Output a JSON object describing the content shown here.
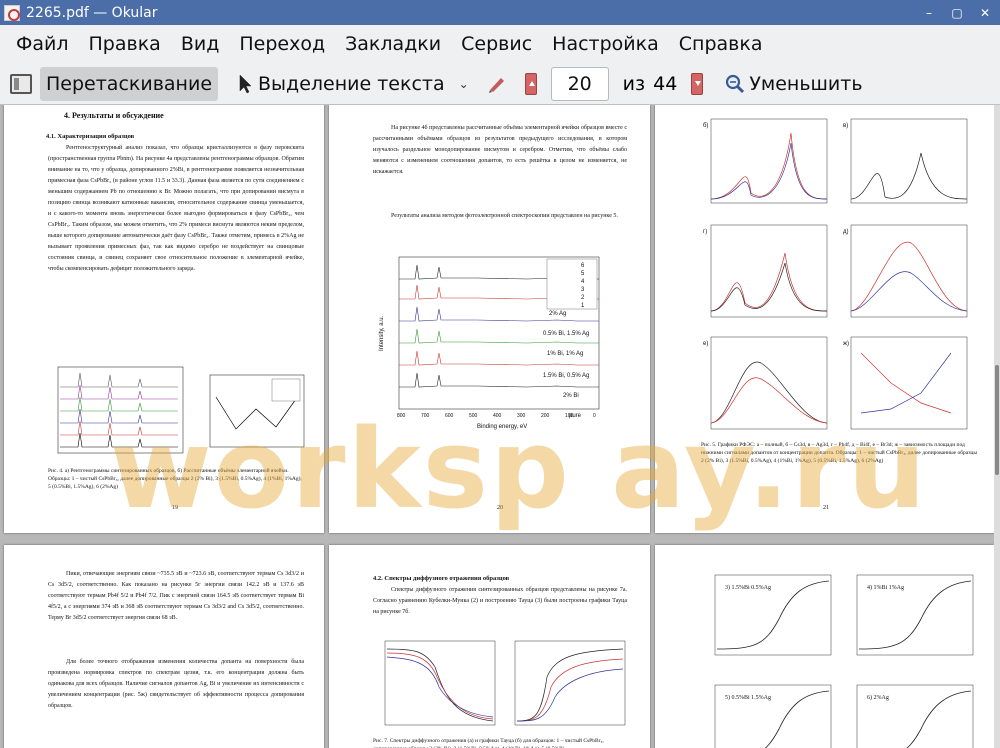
{
  "window": {
    "title": "2265.pdf  — Okular",
    "minimize": "–",
    "maximize": "▢",
    "close": "✕"
  },
  "menu": [
    "Файл",
    "Правка",
    "Вид",
    "Переход",
    "Закладки",
    "Сервис",
    "Настройка",
    "Справка"
  ],
  "toolbar": {
    "drag_label": "Перетаскивание",
    "select_label": "Выделение текста",
    "page_value": "20",
    "of_label": "из",
    "total_pages": "44",
    "zoom_out_label": "Уменьшить"
  },
  "pages": {
    "p19": {
      "heading": "4.  Результаты и обсуждение",
      "subheading": "4.1. Характеризация образцов",
      "body": "Рентгеноструктурный анализ показал, что образцы кристаллизуются в фазу перовскита (пространственная группа Pbnm). На рисунке 4а представлены рентгенограммы образцов. Обратим внимание на то, что у образца, допированного 2%Bi, в рентгенограмме появляется незначительная примесная фаза CsPbBr₂ (в районе углов 11.5 и 33.3). Данная фаза является по сути соединением с меньшим содержанием Pb по отношению к Br. Можно полагать, что при допировании висмута в позицию свинца возникают катионные вакансии, относительное содержание свинца уменьшается, и с какого-то момента вновь энергетически более выгодно формироваться в фазу CsPbBr₂, чем CsPbBr₃. Таким образом, мы можем отметить, что 2% примеси висмута являются неким пределом, выше которого допирование автоматически даёт фазу CsPbBr₂. Также отметим, примесь в 2%Ag не вызывает проявления примесных фаз, так как видимо серебро не воздействует на свинцовые состояния свинца, и свинец сохраняет свое относительное положение в элементарной ячейке, чтобы скомпенсировать дефицит положительного заряда.",
      "caption": "Рис. 4. а) Рентгенограммы синтезированных образцов, б) Рассчитанные объёмы элементарной ячейки. Образцы: 1 – чистый CsPbBr₃, далее допированные образцы 2 (2% Bi), 3 (1.5%Bi, 0.5%Ag), 4 (1%Bi, 1%Ag), 5 (0.5%Bi, 1.5%Ag), 6 (2%Ag)",
      "page_number": "19"
    },
    "p20": {
      "body1": "На рисунке 4б представлены рассчитанные объёмы элементарной ячейки образцов вместе с рассчитанными объёмами образцов из результатов предыдущего исследования, в котором изучалось раздельное монодопирование висмутом и серебром. Отметим, что объёмы слабо меняются с изменением соотношения допантов, то есть решётка в целом не изменяется, не искажается.",
      "body2": "Результаты анализа методом фотоэлектронной спектроскопии представлен на рисунке 5.",
      "series_labels": [
        "2% Ag",
        "0.5% Bi, 1.5% Ag",
        "1% Bi, 1% Ag",
        "1.5% Bi, 0.5% Ag",
        "2% Bi",
        "pure"
      ],
      "legend": [
        "6",
        "5",
        "4",
        "3",
        "2",
        "1"
      ],
      "xlabel": "Binding energy, eV",
      "ylabel": "Intensity, a.u.",
      "x_ticks": [
        "800",
        "700",
        "600",
        "500",
        "400",
        "300",
        "200",
        "100",
        "0"
      ],
      "page_number": "20"
    },
    "p21": {
      "caption": "Рис. 5. Графики РФЭС: а – полный, б – Cs3d, в – Ag3d, г – Pb4f, д – Bi4f, е – Br3d; ж – зависимость площади под нижними сигналами допантов от концентрации допанта. Образцы: 1 – чистый CsPbBr₃, далее допированные образцы 2 (2% Bi), 3 (1.5%Bi, 0.5%Ag), 4 (1%Bi, 1%Ag), 5 (0.5%Bi, 1.5%Ag), 6 (2%Ag)",
      "panel_labels": [
        "б)",
        "в)",
        "г)",
        "д)",
        "е)",
        "ж)"
      ],
      "page_number": "21"
    },
    "p22": {
      "body1": "Пики, отвечающие энергиям связи ~735.5 эВ и ~723.6 эВ, соответствуют термам Cs 3d3/2 и Cs 3d5/2, соответственно. Как показано на рисунке 5г энергии связи 142.2 эВ и 137.6 эВ соответствуют термам Pb4f 5/2 и Pb4f 7/2. Пик с энергией связи 164.5 эВ соответствует термам Bi 4f5/2, а с энергиями 374 эВ и 368 эВ соответствуют термам Cs 3d3/2 and Cs 3d5/2, соответственно. Терму Br 3d5/2 соответствует энергия связи 68 эВ.",
      "body2": "Для более точного отображения изменения количества допанта на поверхности была произведена нормировка спектров по спектрам цезия, т.к. его концентрация должна быть одинакова для всех образцов. Наличие сигналов допантов Ag, Bi и увеличение их интенсивности с увеличением концентрации (рис. 5ж) свидетельствует об эффективности процесса допирования образцов."
    },
    "p23": {
      "heading": "4.2. Спектры диффузного отражения образцов",
      "body": "Спектры диффузного отражения синтезированных образцов представлены на рисунке 7а. Согласно уравнению Кубелки-Мунка (2) и построению Тауца (3) были построены графики Тауца на рисунке 7б.",
      "caption": "Рис. 7. Спектры диффузного отражения (а) и графики Тауца (б) для образцов: 1 – чистый CsPbBr₃, допированные образцы 2 (2% Bi), 3 (1.5%Bi, 0.5%Ag), 4 (1%Bi, 1%Ag), 5 (0.5%Bi..."
    },
    "p24": {
      "panel_labels": [
        "3) 1.5%Bi 0.5%Ag",
        "4) 1%Bi 1%Ag",
        "5) 0.5%Bi 1.5%Ag",
        "6) 2%Ag"
      ]
    }
  },
  "watermark": "worksp ay.ru",
  "colors": {
    "titlebar": "#4b6ea8",
    "menubar": "#eff0f1",
    "docbg": "#b8b8b8"
  }
}
